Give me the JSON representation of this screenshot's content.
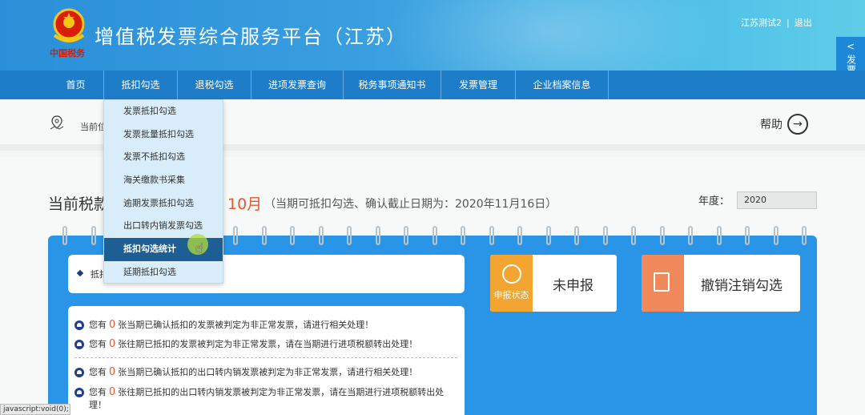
{
  "header": {
    "emblem_text": "中国税务",
    "title": "增值税发票综合服务平台（江苏）",
    "user": "江苏测试2",
    "separator": "|",
    "logout": "退出"
  },
  "side_tab": {
    "chevron": "<",
    "label": "发票查验平台"
  },
  "nav": {
    "items": [
      "首页",
      "抵扣勾选",
      "退税勾选",
      "进项发票查询",
      "税务事项通知书",
      "发票管理",
      "企业档案信息"
    ]
  },
  "breadcrumb": {
    "label": "当前位"
  },
  "help": {
    "label": "帮助"
  },
  "dropdown": {
    "items": [
      "发票抵扣勾选",
      "发票批量抵扣勾选",
      "发票不抵扣勾选",
      "海关缴款书采集",
      "逾期发票抵扣勾选",
      "出口转内销发票勾选",
      "抵扣勾选统计",
      "延期抵扣勾选"
    ],
    "active_index": 6
  },
  "period": {
    "title": "当前税款",
    "month": "10月",
    "note": "（当期可抵扣勾选、确认截止日期为：2020年11月16日）"
  },
  "year": {
    "label": "年度：",
    "value": "2020"
  },
  "notice": {
    "text": "抵扣"
  },
  "messages": [
    {
      "pre": "您有",
      "num": "0",
      "post": "张当期已确认抵扣的发票被判定为非正常发票，请进行相关处理！"
    },
    {
      "pre": "您有",
      "num": "0",
      "post": "张往期已抵扣的发票被判定为非正常发票，请在当期进行进项税额转出处理！"
    },
    {
      "pre": "您有",
      "num": "0",
      "post": "张当期已确认抵扣的出口转内销发票被判定为非正常发票，请进行相关处理！"
    },
    {
      "pre": "您有",
      "num": "0",
      "post": "张往期已抵扣的出口转内销发票被判定为非正常发票，请在当期进行进项税额转出处理！"
    }
  ],
  "status_card": {
    "icon_label": "申报状态",
    "value": "未申报"
  },
  "cancel_card": {
    "label": "撤销注销勾选"
  },
  "statusbar": {
    "text": "javascript:void(0);"
  },
  "colors": {
    "header_blue": "#2a8fd8",
    "nav_blue": "#1e7dc8",
    "panel_blue": "#2a95e6",
    "accent_red": "#e4572e",
    "status_orange": "#f2a531",
    "cancel_orange": "#f08a5d",
    "dropdown_active": "#1d5f95"
  },
  "icons": {
    "emblem": "tax-emblem-icon",
    "location": "location-pin-icon",
    "help": "arrow-right-circle-icon",
    "bell": "bell-icon",
    "status": "user-status-icon",
    "cancel": "document-cancel-icon",
    "cursor": "hand-cursor-icon"
  }
}
